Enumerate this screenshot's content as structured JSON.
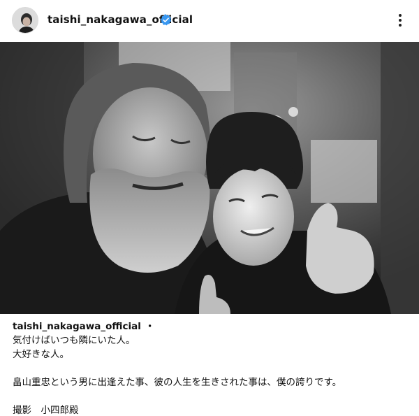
{
  "header": {
    "username": "taishi_nakagawa_official",
    "verified_icon": "verified-badge-icon",
    "more_icon": "more-vertical-icon",
    "accent_color": "#3897f0"
  },
  "photo": {
    "style": "black-and-white"
  },
  "caption": {
    "username": "taishi_nakagawa_official",
    "separator": "・",
    "line1": "気付けばいつも隣にいた人。",
    "line2": "大好きな人。",
    "line3": "畠山重忠という男に出逢えた事、彼の人生を生きされた事は、僕の誇りです。",
    "line4": "撮影　小四郎殿"
  }
}
